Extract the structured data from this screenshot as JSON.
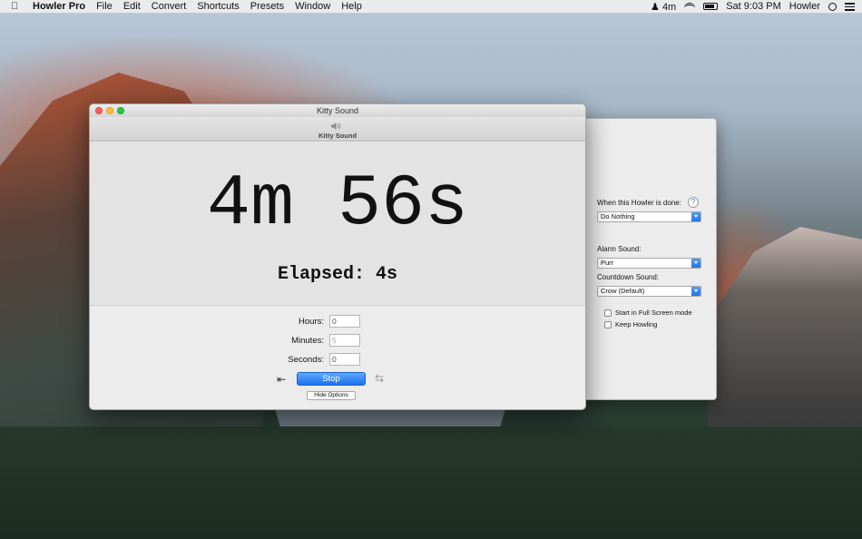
{
  "menubar": {
    "app_name": "Howler Pro",
    "menus": [
      "File",
      "Edit",
      "Convert",
      "Shortcuts",
      "Presets",
      "Window",
      "Help"
    ],
    "status_timer": "4m",
    "clock": "Sat 9:03 PM",
    "user": "Howler"
  },
  "main_window": {
    "title": "Kitty Sound",
    "toolbar_label": "Kitty Sound",
    "countdown": "4m 56s",
    "elapsed": "Elapsed: 4s",
    "fields": {
      "hours_label": "Hours:",
      "hours_value": "0",
      "minutes_label": "Minutes:",
      "minutes_value": "5",
      "seconds_label": "Seconds:",
      "seconds_value": "0"
    },
    "stop_label": "Stop",
    "hide_options_label": "Hide Options"
  },
  "options_window": {
    "done_label": "When this Howler is done:",
    "done_value": "Do Nothing",
    "alarm_label": "Alarm Sound:",
    "alarm_value": "Purr",
    "countdown_label": "Countdown Sound:",
    "countdown_value": "Crow (Default)",
    "fullscreen_label": "Start in Full Screen mode",
    "keep_howling_label": "Keep Howling",
    "help_glyph": "?"
  },
  "icons": [
    "apple-icon",
    "howler-status-icon",
    "wifi-icon",
    "battery-icon",
    "search-icon",
    "list-icon",
    "speaker-icon",
    "reset-icon",
    "repeat-icon",
    "help-icon"
  ],
  "colors": {
    "accent": "#1b73ec",
    "close": "#fc5f57",
    "minimize": "#fdbc2e",
    "maximize": "#29c840"
  }
}
